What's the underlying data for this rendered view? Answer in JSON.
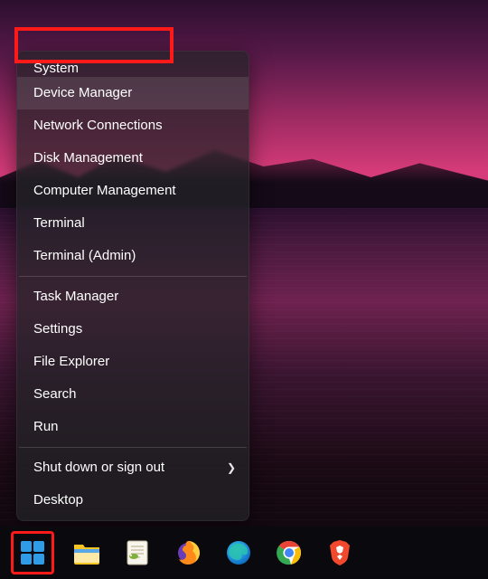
{
  "menu": {
    "group1": [
      "System",
      "Device Manager",
      "Network Connections",
      "Disk Management",
      "Computer Management",
      "Terminal",
      "Terminal (Admin)"
    ],
    "group2": [
      "Task Manager",
      "Settings",
      "File Explorer",
      "Search",
      "Run"
    ],
    "group3": {
      "shutdown": "Shut down or sign out",
      "desktop": "Desktop"
    },
    "highlighted_index": 1
  },
  "taskbar": {
    "icons": {
      "start": "start-icon",
      "explorer": "file-explorer-icon",
      "notepadpp": "notepad-plus-plus-icon",
      "firefox": "firefox-icon",
      "edge": "edge-icon",
      "chrome": "chrome-icon",
      "brave": "brave-icon"
    }
  },
  "colors": {
    "highlight": "#ff1a1a",
    "menu_bg": "rgba(36,36,40,0.72)",
    "menu_hover": "rgba(255,255,255,0.10)"
  }
}
